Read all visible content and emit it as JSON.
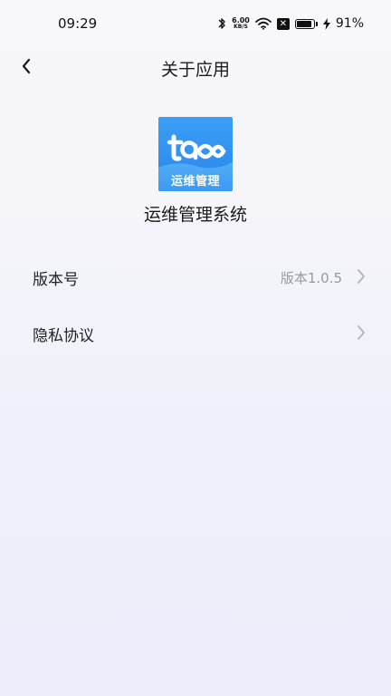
{
  "status_bar": {
    "time": "09:29",
    "net_speed_value": "6.00",
    "net_speed_unit": "KB/S",
    "battery_percent": "91%",
    "battery_level": 0.91
  },
  "header": {
    "title": "关于应用"
  },
  "app": {
    "logo_caption": "运维管理",
    "name": "运维管理系统"
  },
  "list": {
    "items": [
      {
        "label": "版本号",
        "value": "版本1.0.5"
      },
      {
        "label": "隐私协议",
        "value": ""
      }
    ]
  },
  "colors": {
    "logo_blue": "#2a86ec",
    "value_gray": "#9a9a9a",
    "chevron_gray": "#b5b5b5"
  }
}
